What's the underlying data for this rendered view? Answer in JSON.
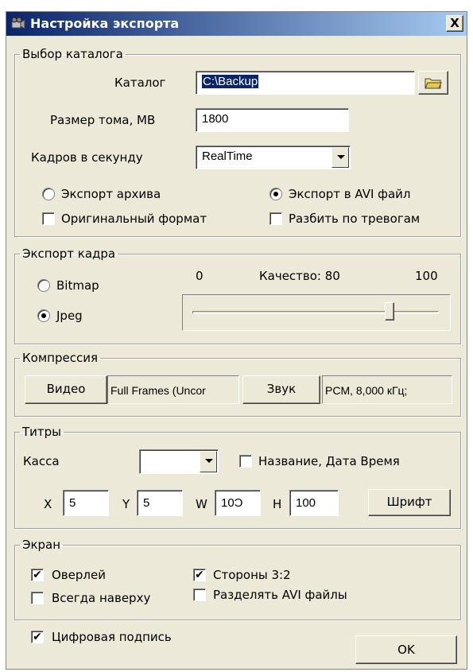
{
  "window": {
    "title": "Настройка экспорта",
    "close_label": "X"
  },
  "catalog_group": {
    "legend": "Выбор каталога",
    "catalog_label": "Каталог",
    "catalog_value": "C:\\Backup",
    "volume_label": "Размер тома, MB",
    "volume_value": "1800",
    "fps_label": "Кадров в секунду",
    "fps_value": "RealTime",
    "export_archive_label": "Экспорт архива",
    "export_avi_label": "Экспорт в AVI файл",
    "original_format_label": "Оригинальный формат",
    "split_alarms_label": "Разбить по тревогам"
  },
  "frame_group": {
    "legend": "Экспорт кадра",
    "bitmap_label": "Bitmap",
    "jpeg_label": "Jpeg",
    "min_label": "0",
    "quality_label": "Качество: 80",
    "max_label": "100",
    "quality_value": 80,
    "quality_min": 0,
    "quality_max": 100
  },
  "compression_group": {
    "legend": "Компрессия",
    "video_button": "Видео",
    "video_codec": "Full Frames (Uncor",
    "sound_button": "Звук",
    "sound_codec": "PCM, 8,000 кГц;"
  },
  "titles_group": {
    "legend": "Титры",
    "cash_label": "Касса",
    "cash_value": "",
    "name_datetime_label": "Название, Дата Время",
    "x_label": "X",
    "x_value": "5",
    "y_label": "Y",
    "y_value": "5",
    "w_label": "W",
    "w_value": "10Ͻ",
    "h_label": "H",
    "h_value": "100",
    "font_button": "Шрифт"
  },
  "screen_group": {
    "legend": "Экран",
    "overlay_label": "Оверлей",
    "aspect_label": "Стороны 3:2",
    "always_top_label": "Всегда наверху",
    "split_avi_label": "Разделять AVI файлы"
  },
  "footer": {
    "digital_signature_label": "Цифровая подпись",
    "ok_button": "OK"
  },
  "state": {
    "export_archive": false,
    "export_avi": true,
    "original_format": false,
    "split_alarms": false,
    "bitmap": false,
    "jpeg": true,
    "name_datetime": false,
    "overlay": true,
    "aspect": true,
    "always_top": false,
    "split_avi": false,
    "digital_signature": true
  },
  "icons": {
    "app": "film-camera-icon",
    "folder": "folder-icon",
    "dropdown": "chevron-down-icon"
  }
}
